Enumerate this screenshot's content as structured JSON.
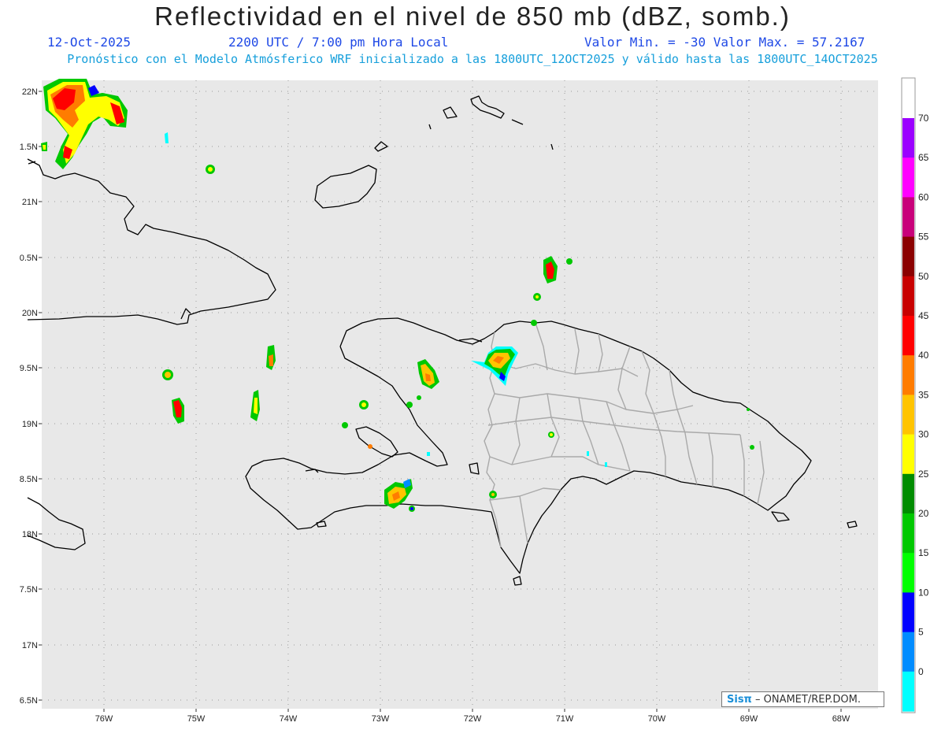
{
  "header": {
    "title": "Reflectividad en el nivel de 850 mb (dBZ, somb.)",
    "date": "12-Oct-2025",
    "time": "2200 UTC / 7:00 pm Hora Local",
    "range": "Valor Min. = -30  Valor Max. = 57.2167",
    "forecast": "Pronóstico con el Modelo Atmósferico WRF inicializado a las 1800UTC_12OCT2025 y válido hasta las  1800UTC_14OCT2025"
  },
  "map": {
    "lon_ticks": [
      "76W",
      "75W",
      "74W",
      "73W",
      "72W",
      "71W",
      "70W",
      "69W",
      "68W"
    ],
    "lat_ticks": [
      "22N",
      "1.5N",
      "21N",
      "0.5N",
      "20N",
      "9.5N",
      "19N",
      "8.5N",
      "18N",
      "7.5N",
      "17N",
      "6.5N"
    ],
    "land_color": "#e6e6e6",
    "coast_color": "#000000",
    "border_color": "#a8a8a8"
  },
  "colorbar": {
    "levels": [
      "70",
      "65",
      "60",
      "55",
      "50",
      "45",
      "40",
      "35",
      "30",
      "25",
      "20",
      "15",
      "10",
      "5",
      "0"
    ],
    "colors": [
      "#9b00ff",
      "#ff00ff",
      "#c8007a",
      "#8b0000",
      "#c80000",
      "#ff0000",
      "#ff7c00",
      "#ffc400",
      "#ffff00",
      "#008c00",
      "#00c800",
      "#00ff00",
      "#0000ff",
      "#008cff",
      "#00ffff"
    ]
  },
  "credit": {
    "sis": "Sisπ",
    "org": "– ONAMET/REP.DOM."
  }
}
